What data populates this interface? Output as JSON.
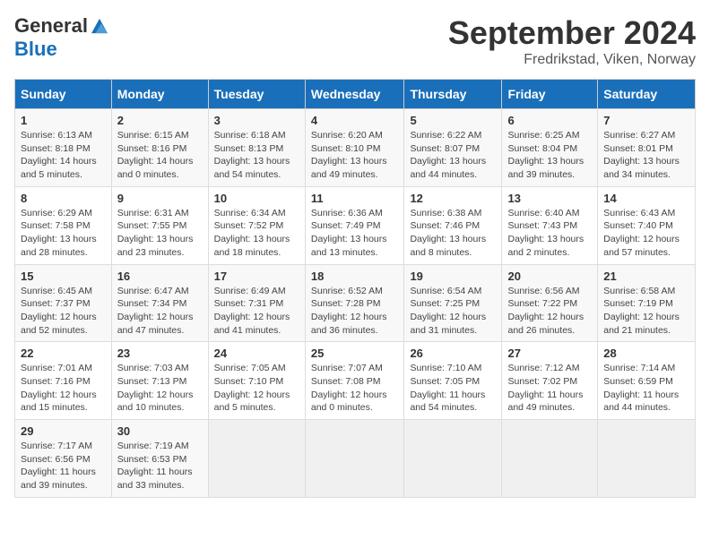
{
  "logo": {
    "general": "General",
    "blue": "Blue"
  },
  "title": "September 2024",
  "location": "Fredrikstad, Viken, Norway",
  "days_of_week": [
    "Sunday",
    "Monday",
    "Tuesday",
    "Wednesday",
    "Thursday",
    "Friday",
    "Saturday"
  ],
  "weeks": [
    [
      {
        "day": "1",
        "sunrise": "6:13 AM",
        "sunset": "8:18 PM",
        "daylight": "14 hours and 5 minutes."
      },
      {
        "day": "2",
        "sunrise": "6:15 AM",
        "sunset": "8:16 PM",
        "daylight": "14 hours and 0 minutes."
      },
      {
        "day": "3",
        "sunrise": "6:18 AM",
        "sunset": "8:13 PM",
        "daylight": "13 hours and 54 minutes."
      },
      {
        "day": "4",
        "sunrise": "6:20 AM",
        "sunset": "8:10 PM",
        "daylight": "13 hours and 49 minutes."
      },
      {
        "day": "5",
        "sunrise": "6:22 AM",
        "sunset": "8:07 PM",
        "daylight": "13 hours and 44 minutes."
      },
      {
        "day": "6",
        "sunrise": "6:25 AM",
        "sunset": "8:04 PM",
        "daylight": "13 hours and 39 minutes."
      },
      {
        "day": "7",
        "sunrise": "6:27 AM",
        "sunset": "8:01 PM",
        "daylight": "13 hours and 34 minutes."
      }
    ],
    [
      {
        "day": "8",
        "sunrise": "6:29 AM",
        "sunset": "7:58 PM",
        "daylight": "13 hours and 28 minutes."
      },
      {
        "day": "9",
        "sunrise": "6:31 AM",
        "sunset": "7:55 PM",
        "daylight": "13 hours and 23 minutes."
      },
      {
        "day": "10",
        "sunrise": "6:34 AM",
        "sunset": "7:52 PM",
        "daylight": "13 hours and 18 minutes."
      },
      {
        "day": "11",
        "sunrise": "6:36 AM",
        "sunset": "7:49 PM",
        "daylight": "13 hours and 13 minutes."
      },
      {
        "day": "12",
        "sunrise": "6:38 AM",
        "sunset": "7:46 PM",
        "daylight": "13 hours and 8 minutes."
      },
      {
        "day": "13",
        "sunrise": "6:40 AM",
        "sunset": "7:43 PM",
        "daylight": "13 hours and 2 minutes."
      },
      {
        "day": "14",
        "sunrise": "6:43 AM",
        "sunset": "7:40 PM",
        "daylight": "12 hours and 57 minutes."
      }
    ],
    [
      {
        "day": "15",
        "sunrise": "6:45 AM",
        "sunset": "7:37 PM",
        "daylight": "12 hours and 52 minutes."
      },
      {
        "day": "16",
        "sunrise": "6:47 AM",
        "sunset": "7:34 PM",
        "daylight": "12 hours and 47 minutes."
      },
      {
        "day": "17",
        "sunrise": "6:49 AM",
        "sunset": "7:31 PM",
        "daylight": "12 hours and 41 minutes."
      },
      {
        "day": "18",
        "sunrise": "6:52 AM",
        "sunset": "7:28 PM",
        "daylight": "12 hours and 36 minutes."
      },
      {
        "day": "19",
        "sunrise": "6:54 AM",
        "sunset": "7:25 PM",
        "daylight": "12 hours and 31 minutes."
      },
      {
        "day": "20",
        "sunrise": "6:56 AM",
        "sunset": "7:22 PM",
        "daylight": "12 hours and 26 minutes."
      },
      {
        "day": "21",
        "sunrise": "6:58 AM",
        "sunset": "7:19 PM",
        "daylight": "12 hours and 21 minutes."
      }
    ],
    [
      {
        "day": "22",
        "sunrise": "7:01 AM",
        "sunset": "7:16 PM",
        "daylight": "12 hours and 15 minutes."
      },
      {
        "day": "23",
        "sunrise": "7:03 AM",
        "sunset": "7:13 PM",
        "daylight": "12 hours and 10 minutes."
      },
      {
        "day": "24",
        "sunrise": "7:05 AM",
        "sunset": "7:10 PM",
        "daylight": "12 hours and 5 minutes."
      },
      {
        "day": "25",
        "sunrise": "7:07 AM",
        "sunset": "7:08 PM",
        "daylight": "12 hours and 0 minutes."
      },
      {
        "day": "26",
        "sunrise": "7:10 AM",
        "sunset": "7:05 PM",
        "daylight": "11 hours and 54 minutes."
      },
      {
        "day": "27",
        "sunrise": "7:12 AM",
        "sunset": "7:02 PM",
        "daylight": "11 hours and 49 minutes."
      },
      {
        "day": "28",
        "sunrise": "7:14 AM",
        "sunset": "6:59 PM",
        "daylight": "11 hours and 44 minutes."
      }
    ],
    [
      {
        "day": "29",
        "sunrise": "7:17 AM",
        "sunset": "6:56 PM",
        "daylight": "11 hours and 39 minutes."
      },
      {
        "day": "30",
        "sunrise": "7:19 AM",
        "sunset": "6:53 PM",
        "daylight": "11 hours and 33 minutes."
      },
      null,
      null,
      null,
      null,
      null
    ]
  ]
}
